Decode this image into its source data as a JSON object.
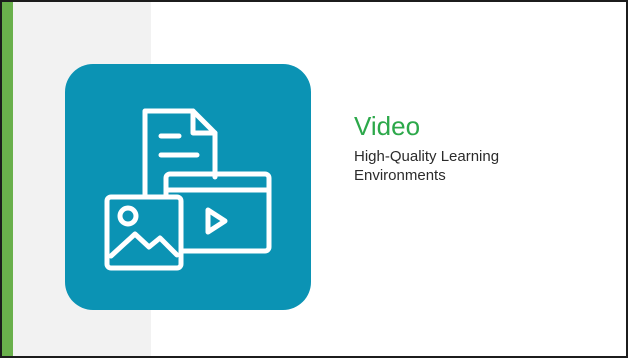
{
  "slide": {
    "title": "Video",
    "subtitle": "High-Quality Learning Environments"
  },
  "icon": {
    "name": "video-document-media-icon"
  },
  "colors": {
    "accent": "#6ab04c",
    "panel": "#f2f2f2",
    "tile": "#0b93b4",
    "title": "#2ca84a",
    "icon_stroke": "#ffffff"
  }
}
